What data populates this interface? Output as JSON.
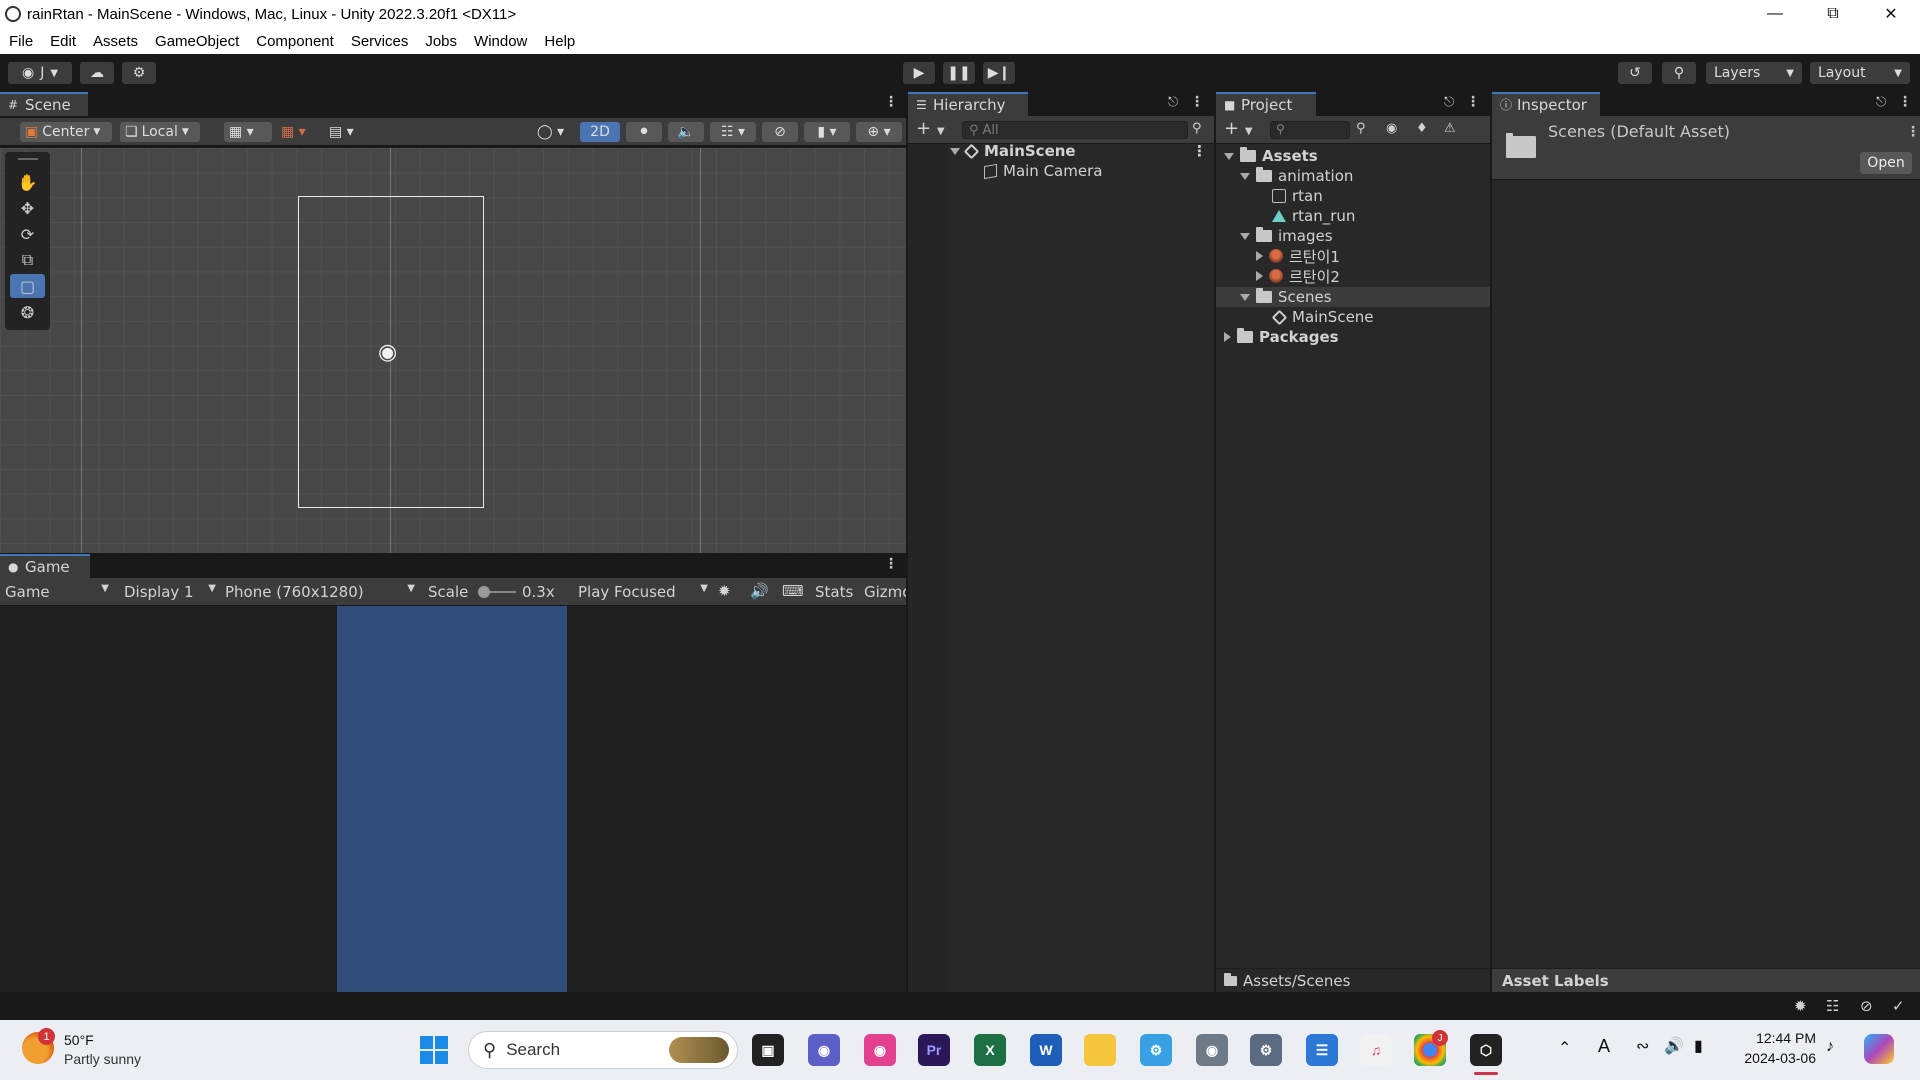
{
  "window": {
    "title": "rainRtan - MainScene - Windows, Mac, Linux - Unity 2022.3.20f1 <DX11>"
  },
  "menu": [
    "File",
    "Edit",
    "Assets",
    "GameObject",
    "Component",
    "Services",
    "Jobs",
    "Window",
    "Help"
  ],
  "toolbar": {
    "account_label": "J",
    "layers_label": "Layers",
    "layout_label": "Layout"
  },
  "scene": {
    "tab_label": "Scene",
    "pivot_label": "Center",
    "space_label": "Local",
    "mode_2d_label": "2D"
  },
  "game": {
    "tab_label": "Game",
    "mode_label": "Game",
    "display_label": "Display 1",
    "resolution_label": "Phone (760x1280)",
    "scale_label": "Scale",
    "scale_value": "0.3x",
    "play_focus_label": "Play Focused",
    "stats_label": "Stats",
    "gizmos_label": "Gizmo"
  },
  "hierarchy": {
    "tab_label": "Hierarchy",
    "search_placeholder": "All",
    "scene_name": "MainScene",
    "items": [
      "Main Camera"
    ]
  },
  "project": {
    "tab_label": "Project",
    "tree": {
      "assets": "Assets",
      "animation": "animation",
      "anim_items": [
        "rtan",
        "rtan_run"
      ],
      "images": "images",
      "image_items": [
        "르탄이1",
        "르탄이2"
      ],
      "scenes": "Scenes",
      "scene_items": [
        "MainScene"
      ],
      "packages": "Packages"
    },
    "footer_path": "Assets/Scenes"
  },
  "inspector": {
    "tab_label": "Inspector",
    "asset_title": "Scenes (Default Asset)",
    "open_button": "Open",
    "asset_labels": "Asset Labels"
  },
  "taskbar": {
    "weather_temp": "50°F",
    "weather_desc": "Partly sunny",
    "weather_badge": "1",
    "search_label": "Search",
    "time": "12:44 PM",
    "date": "2024-03-06",
    "chrome_badge": "J",
    "ime_label": "A"
  },
  "colors": {
    "accent": "#3a79bb",
    "game_bg": "#314d79",
    "panel": "#282828"
  }
}
